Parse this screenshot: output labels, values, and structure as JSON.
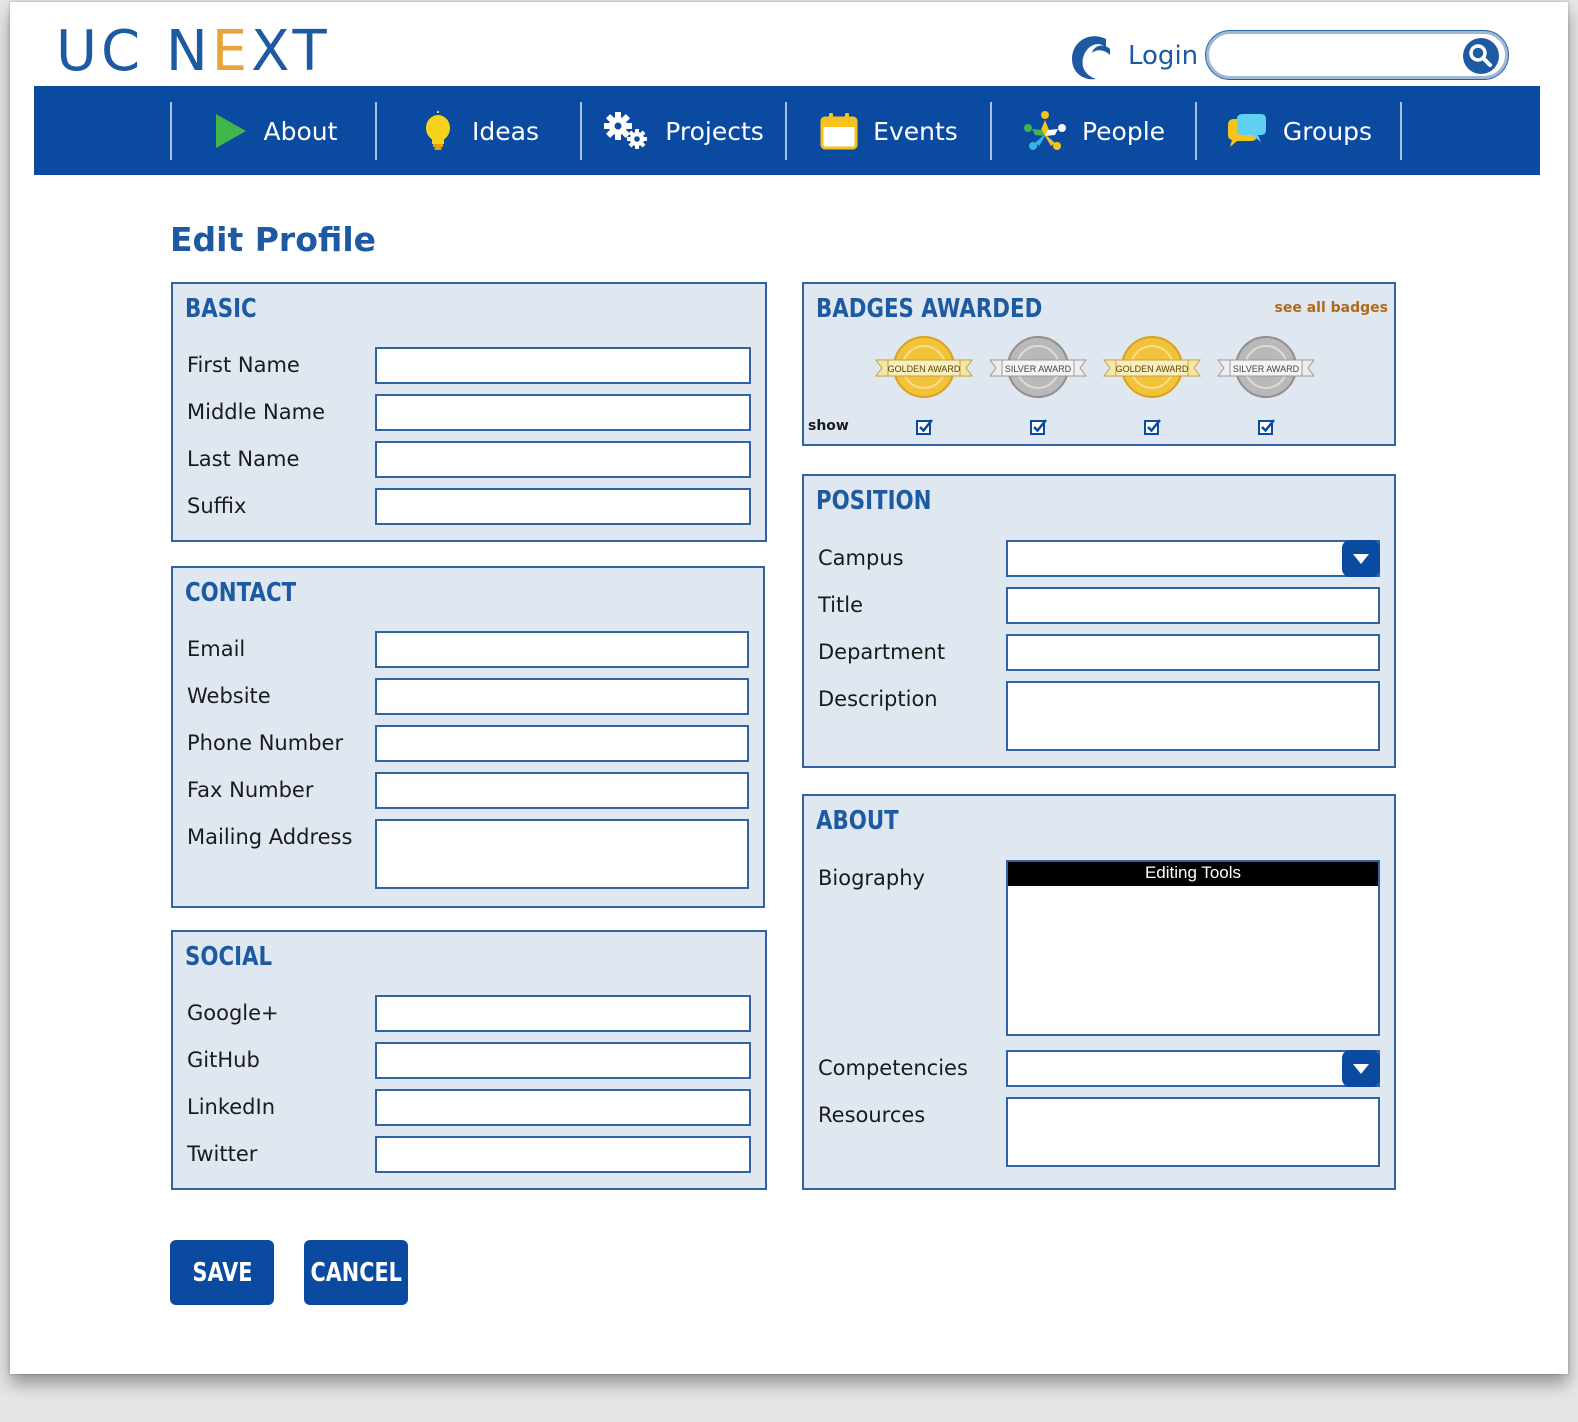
{
  "brand": {
    "logo_text_left": "UC N",
    "logo_text_x": "E",
    "logo_text_right": "XT"
  },
  "header": {
    "login_label": "Login",
    "search_placeholder": "",
    "search_value": ""
  },
  "nav": {
    "items": [
      {
        "label": "About",
        "icon": "play-icon"
      },
      {
        "label": "Ideas",
        "icon": "lightbulb-icon"
      },
      {
        "label": "Projects",
        "icon": "gears-icon"
      },
      {
        "label": "Events",
        "icon": "calendar-icon"
      },
      {
        "label": "People",
        "icon": "people-icon"
      },
      {
        "label": "Groups",
        "icon": "chat-bubbles-icon"
      }
    ]
  },
  "page": {
    "title": "Edit Profile"
  },
  "basic": {
    "title": "BASIC",
    "fields": [
      {
        "label": "First Name",
        "value": ""
      },
      {
        "label": "Middle Name",
        "value": ""
      },
      {
        "label": "Last Name",
        "value": ""
      },
      {
        "label": "Suffix",
        "value": ""
      }
    ]
  },
  "contact": {
    "title": "CONTACT",
    "fields": [
      {
        "label": "Email",
        "value": ""
      },
      {
        "label": "Website",
        "value": ""
      },
      {
        "label": "Phone Number",
        "value": ""
      },
      {
        "label": "Fax Number",
        "value": ""
      }
    ],
    "mailing_label": "Mailing Address",
    "mailing_value": ""
  },
  "social": {
    "title": "SOCIAL",
    "fields": [
      {
        "label": "Google+",
        "value": ""
      },
      {
        "label": "GitHub",
        "value": ""
      },
      {
        "label": "LinkedIn",
        "value": ""
      },
      {
        "label": "Twitter",
        "value": ""
      }
    ]
  },
  "badges": {
    "title": "BADGES AWARDED",
    "see_all": "see all badges",
    "show_label": "show",
    "items": [
      {
        "caption": "GOLDEN AWARD",
        "kind": "gold",
        "shown": true
      },
      {
        "caption": "SILVER AWARD",
        "kind": "silver",
        "shown": true
      },
      {
        "caption": "GOLDEN AWARD",
        "kind": "gold",
        "shown": true
      },
      {
        "caption": "SILVER AWARD",
        "kind": "silver",
        "shown": true
      }
    ]
  },
  "position": {
    "title": "POSITION",
    "campus_label": "Campus",
    "campus_value": "",
    "title_label": "Title",
    "title_value": "",
    "department_label": "Department",
    "department_value": "",
    "description_label": "Description",
    "description_value": ""
  },
  "about": {
    "title": "ABOUT",
    "biography_label": "Biography",
    "editor_toolbar": "Editing Tools",
    "biography_value": "",
    "competencies_label": "Competencies",
    "competencies_value": "",
    "resources_label": "Resources",
    "resources_value": ""
  },
  "actions": {
    "save_label": "SAVE",
    "cancel_label": "CANCEL"
  },
  "colors": {
    "brand_blue": "#0b4aa1",
    "heading_blue": "#1d5aa2",
    "panel_bg": "#dfe7f0",
    "accent_orange": "#e8a33a",
    "gold": "#f2c23a",
    "silver": "#b9b9b9"
  }
}
